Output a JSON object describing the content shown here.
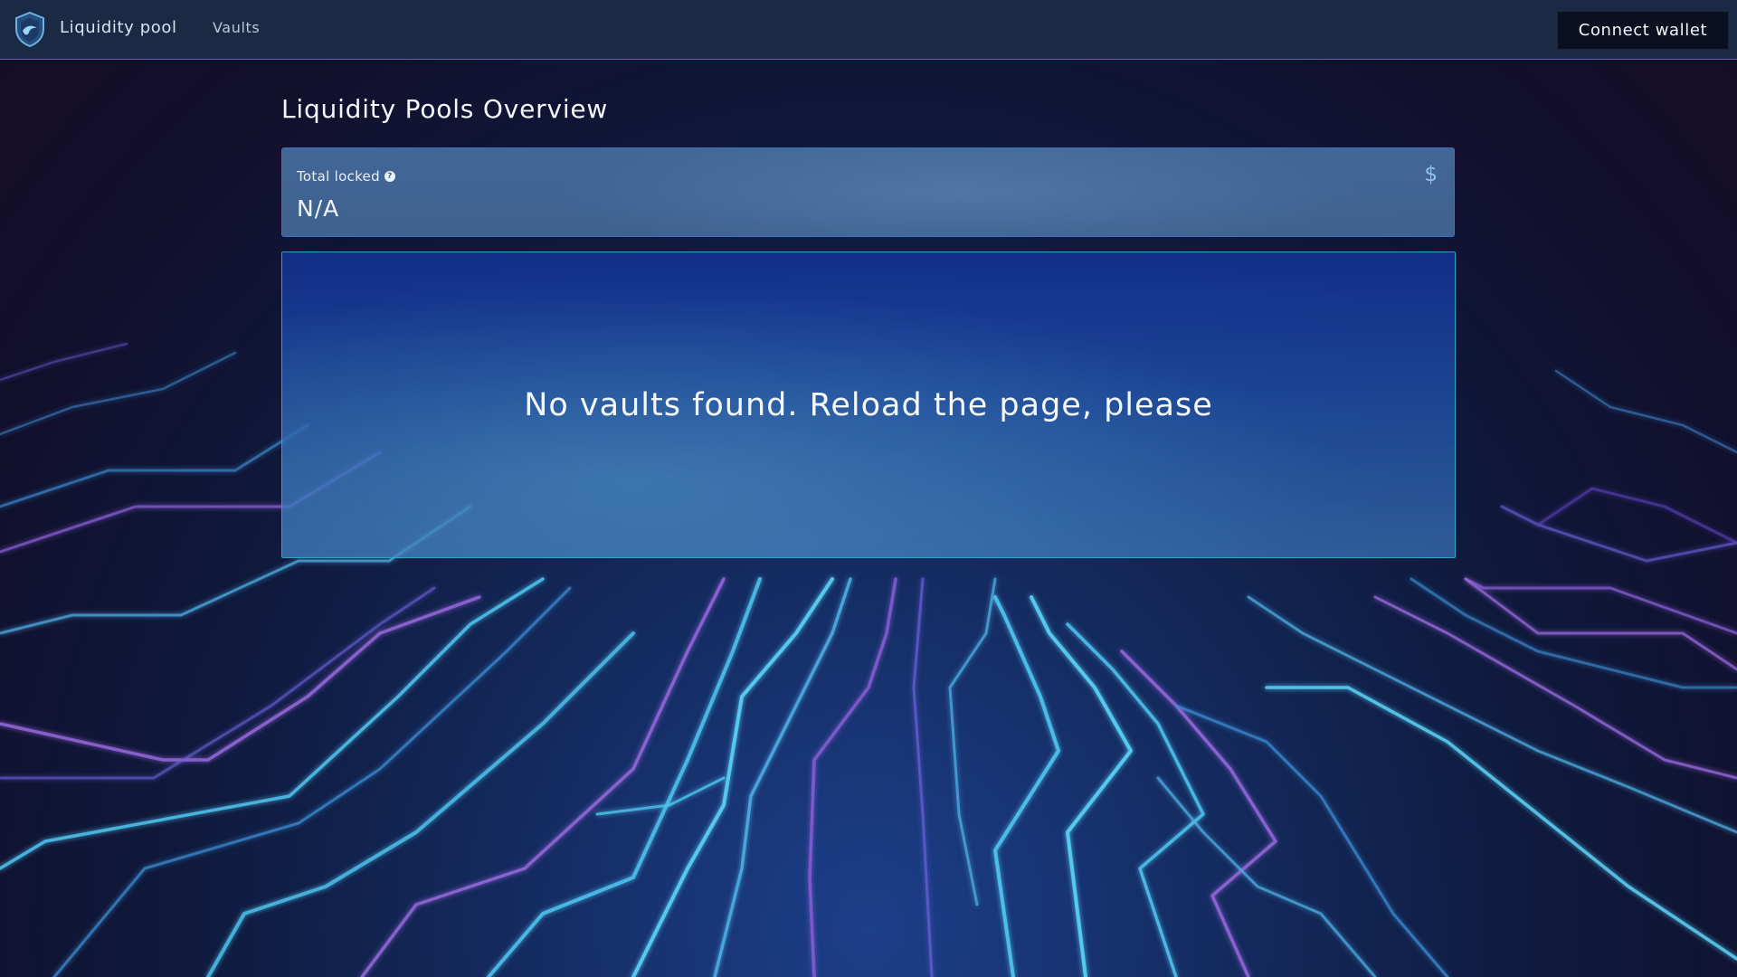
{
  "header": {
    "brand_label": "Liquidity pool",
    "nav_vaults_label": "Vaults",
    "connect_wallet_label": "Connect wallet",
    "logo_icon": "shield-wave-icon"
  },
  "main": {
    "page_title": "Liquidity Pools Overview",
    "stat_card": {
      "label": "Total locked",
      "help_icon": "question-circle-icon",
      "help_glyph": "?",
      "value": "N/A",
      "currency_icon": "dollar-icon",
      "currency_glyph": "$"
    },
    "empty_panel": {
      "message": "No vaults found. Reload the page, please"
    }
  },
  "colors": {
    "header_bg": "#1a2a44",
    "accent_border": "#2c7fa7",
    "button_bg": "#0b1020",
    "circuit_cyan": "#4fc3ee",
    "circuit_purple": "#9a6ae0"
  }
}
